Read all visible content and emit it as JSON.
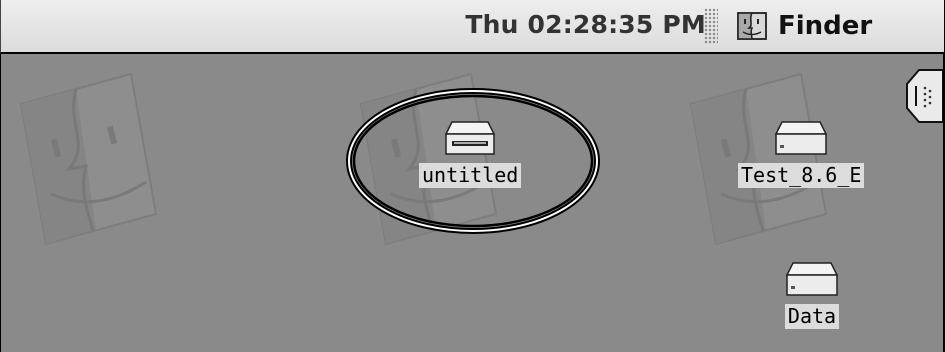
{
  "menubar": {
    "clock": "Thu 02:28:35 PM",
    "app_name": "Finder",
    "app_icon": "finder-face-icon"
  },
  "desktop": {
    "background_color": "#8a8a8a",
    "icons": [
      {
        "label": "untitled",
        "icon": "removable-disk-icon",
        "selected": true
      },
      {
        "label": "Test_8.6_E",
        "icon": "hard-disk-icon",
        "selected": false
      },
      {
        "label": "Data",
        "icon": "hard-disk-icon",
        "selected": false
      }
    ]
  },
  "annotation": {
    "highlight_target": "untitled"
  }
}
